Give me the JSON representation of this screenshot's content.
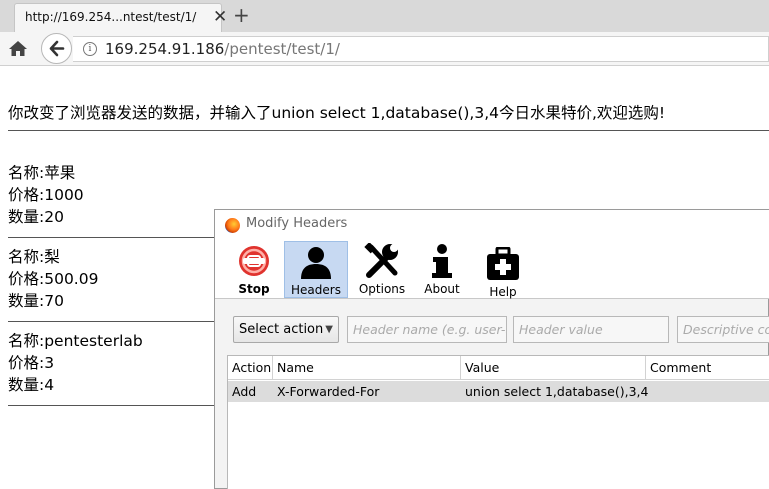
{
  "browser": {
    "tab_title": "http://169.254...ntest/test/1/",
    "tab_close": "✕",
    "new_tab": "+",
    "url_host": "169.254.91.186",
    "url_path": "/pentest/test/1/"
  },
  "page": {
    "headline": "你改变了浏览器发送的数据，并输入了union select 1,database(),3,4今日水果特价,欢迎选购!",
    "products": [
      {
        "name": "名称:苹果",
        "price": "价格:1000",
        "qty": "数量:20"
      },
      {
        "name": "名称:梨",
        "price": "价格:500.09",
        "qty": "数量:70"
      },
      {
        "name": "名称:pentesterlab",
        "price": "价格:3",
        "qty": "数量:4"
      }
    ]
  },
  "modify_headers": {
    "title": "Modify Headers",
    "toolbar": {
      "stop": "Stop",
      "headers": "Headers",
      "options": "Options",
      "about": "About",
      "help": "Help"
    },
    "select_action": "Select action",
    "header_name_placeholder": "Header name (e.g. user-agent)",
    "header_value_placeholder": "Header value",
    "description_placeholder": "Descriptive comment",
    "columns": [
      "Action",
      "Name",
      "Value",
      "Comment"
    ],
    "rows": [
      {
        "action": "Add",
        "name": "X-Forwarded-For",
        "value": "union select 1,database(),3,4",
        "comment": ""
      }
    ]
  },
  "colors": {
    "active_button": "#c7d9f2",
    "stop_red": "#e0332e",
    "selected_row": "#dcdcdc"
  }
}
